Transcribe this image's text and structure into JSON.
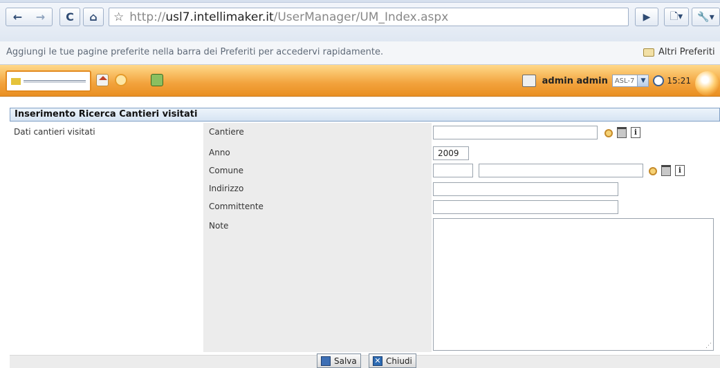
{
  "browser": {
    "back_glyph": "←",
    "forward_glyph": "→",
    "reload_glyph": "C",
    "home_glyph": "⌂",
    "star_glyph": "☆",
    "url_prefix": "http://",
    "url_domain": "usl7.intellimaker.it",
    "url_path": "/UserManager/UM_Index.aspx",
    "play_glyph": "▶",
    "page_glyph": "🗋▾",
    "wrench_glyph": "🔧▾"
  },
  "bookmarks": {
    "hint": "Aggiungi le tue pagine preferite nella barra dei Preferiti per accedervi rapidamente.",
    "other_folder": "Altri Preferiti"
  },
  "app_header": {
    "user_name": "admin admin",
    "asl_value": "ASL-7",
    "time": "15:21"
  },
  "form": {
    "title": "Inserimento Ricerca Cantieri visitati",
    "section_label": "Dati cantieri visitati",
    "fields": {
      "cantiere": {
        "label": "Cantiere",
        "value": ""
      },
      "anno": {
        "label": "Anno",
        "value": "2009"
      },
      "comune": {
        "label": "Comune",
        "code_value": "",
        "value": ""
      },
      "indirizzo": {
        "label": "Indirizzo",
        "value": ""
      },
      "committente": {
        "label": "Committente",
        "value": ""
      },
      "note": {
        "label": "Note",
        "value": ""
      }
    }
  },
  "actions": {
    "save_label": "Salva",
    "close_label": "Chiudi"
  }
}
